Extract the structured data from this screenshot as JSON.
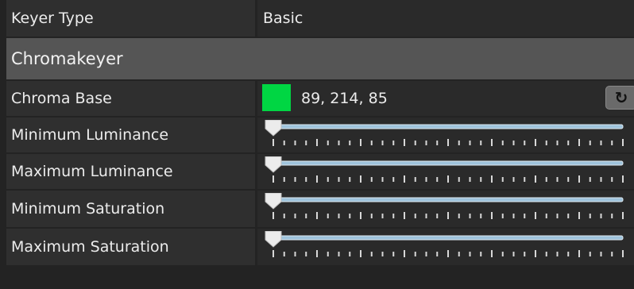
{
  "keyer_type": {
    "label": "Keyer Type",
    "value": "Basic"
  },
  "section": {
    "title": "Chromakeyer"
  },
  "chroma_base": {
    "label": "Chroma Base",
    "color": "#00d643",
    "rgb_text": "89, 214, 85",
    "reset_icon": "reset-icon"
  },
  "sliders": [
    {
      "label": "Minimum Luminance",
      "value": 0
    },
    {
      "label": "Maximum Luminance",
      "value": 0
    },
    {
      "label": "Minimum Saturation",
      "value": 0
    },
    {
      "label": "Maximum Saturation",
      "value": 0
    }
  ]
}
